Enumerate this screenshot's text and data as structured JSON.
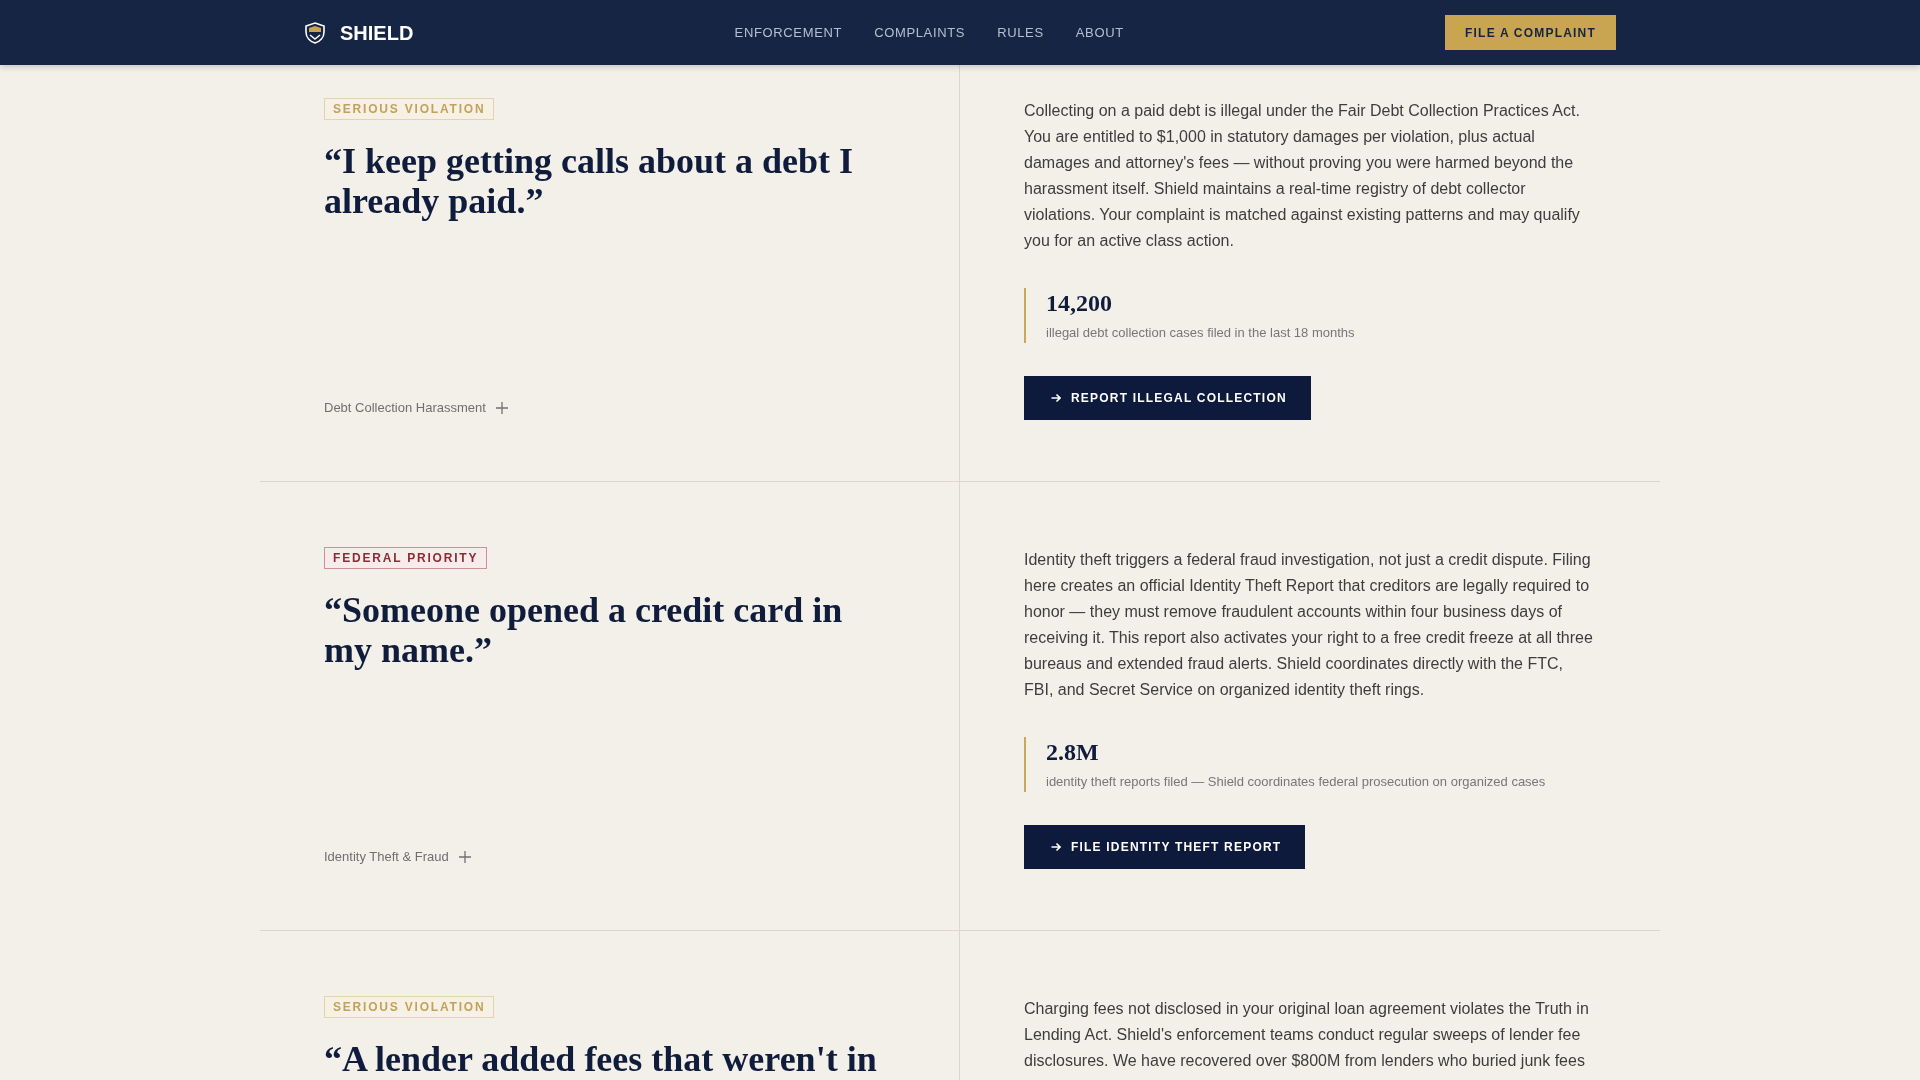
{
  "header": {
    "brand": "SHIELD",
    "nav": [
      "ENFORCEMENT",
      "COMPLAINTS",
      "RULES",
      "ABOUT"
    ],
    "cta": "FILE A COMPLAINT"
  },
  "cases": [
    {
      "tag": {
        "label": "SERIOUS VIOLATION",
        "kind": "serious"
      },
      "quote": "“I keep getting calls about a debt I already paid.”",
      "category": "Debt Collection Harassment",
      "description": "Collecting on a paid debt is illegal under the Fair Debt Collection Practices Act. You are entitled to $1,000 in statutory damages per violation, plus actual damages and attorney's fees — without proving you were harmed beyond the harassment itself. Shield maintains a real-time registry of debt collector violations. Your complaint is matched against existing patterns and may qualify you for an active class action.",
      "stat": {
        "value": "14,200",
        "caption": "illegal debt collection cases filed in the last 18 months"
      },
      "action": "REPORT ILLEGAL COLLECTION"
    },
    {
      "tag": {
        "label": "FEDERAL PRIORITY",
        "kind": "federal"
      },
      "quote": "“Someone opened a credit card in my name.”",
      "category": "Identity Theft & Fraud",
      "description": "Identity theft triggers a federal fraud investigation, not just a credit dispute. Filing here creates an official Identity Theft Report that creditors are legally required to honor — they must remove fraudulent accounts within four business days of receiving it. This report also activates your right to a free credit freeze at all three bureaus and extended fraud alerts. Shield coordinates directly with the FTC, FBI, and Secret Service on organized identity theft rings.",
      "stat": {
        "value": "2.8M",
        "caption": "identity theft reports filed — Shield coordinates federal prosecution on organized cases"
      },
      "action": "FILE IDENTITY THEFT REPORT"
    },
    {
      "tag": {
        "label": "SERIOUS VIOLATION",
        "kind": "serious"
      },
      "quote": "“A lender added fees that weren't in",
      "description": "Charging fees not disclosed in your original loan agreement violates the Truth in Lending Act. Shield's enforcement teams conduct regular sweeps of lender fee disclosures. We have recovered over $800M from lenders who buried junk fees"
    }
  ]
}
